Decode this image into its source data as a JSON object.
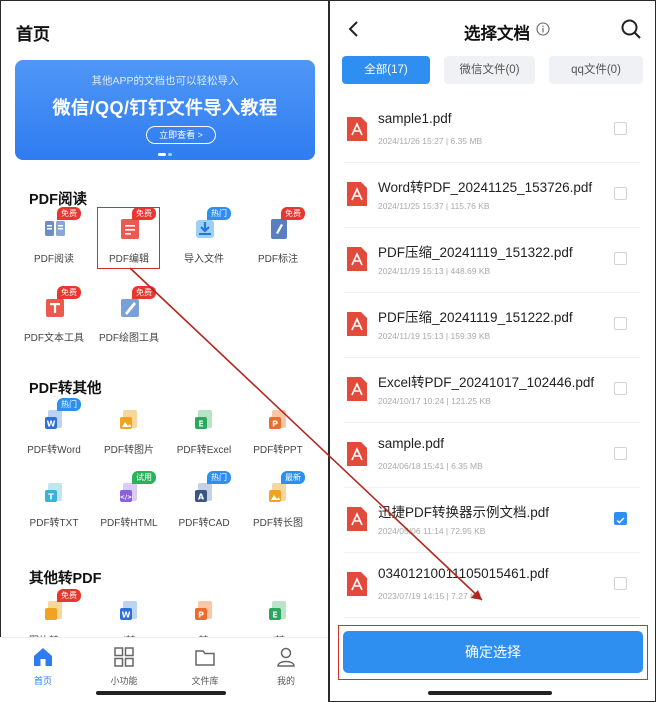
{
  "left": {
    "title": "首页",
    "banner": {
      "subtitle": "其他APP的文档也可以轻松导入",
      "headline": "微信/QQ/钉钉文件导入教程",
      "cta": "立即查看 >"
    },
    "sections": [
      {
        "title": "PDF阅读",
        "tools": [
          {
            "label": "PDF阅读",
            "icon": "book-icon",
            "badge": "免费",
            "badge_color": "#e8372e"
          },
          {
            "label": "PDF编辑",
            "icon": "edit-doc-icon",
            "badge": "免费",
            "badge_color": "#e8372e"
          },
          {
            "label": "导入文件",
            "icon": "import-icon",
            "badge": "热门",
            "badge_color": "#2f8ff0"
          },
          {
            "label": "PDF标注",
            "icon": "annotate-icon",
            "badge": "免费",
            "badge_color": "#e8372e"
          },
          {
            "label": "PDF文本工具",
            "icon": "text-tool-icon",
            "badge": "免费",
            "badge_color": "#e8372e"
          },
          {
            "label": "PDF绘图工具",
            "icon": "draw-tool-icon",
            "badge": "免费",
            "badge_color": "#e8372e"
          }
        ]
      },
      {
        "title": "PDF转其他",
        "tools": [
          {
            "label": "PDF转Word",
            "icon": "word-icon",
            "badge": "热门",
            "badge_color": "#2f8ff0"
          },
          {
            "label": "PDF转图片",
            "icon": "image-icon",
            "badge": "",
            "badge_color": ""
          },
          {
            "label": "PDF转Excel",
            "icon": "excel-icon",
            "badge": "",
            "badge_color": ""
          },
          {
            "label": "PDF转PPT",
            "icon": "ppt-icon",
            "badge": "",
            "badge_color": ""
          },
          {
            "label": "PDF转TXT",
            "icon": "txt-icon",
            "badge": "",
            "badge_color": ""
          },
          {
            "label": "PDF转HTML",
            "icon": "html-icon",
            "badge": "试用",
            "badge_color": "#26b35a"
          },
          {
            "label": "PDF转CAD",
            "icon": "cad-icon",
            "badge": "热门",
            "badge_color": "#2f8ff0"
          },
          {
            "label": "PDF转长图",
            "icon": "long-image-icon",
            "badge": "最新",
            "badge_color": "#2f8ff0"
          }
        ]
      },
      {
        "title": "其他转PDF",
        "tools": [
          {
            "label": "图片转PDF",
            "icon": "image-icon",
            "badge": "免费",
            "badge_color": "#e8372e"
          },
          {
            "label": "Word转PDF",
            "icon": "word-icon",
            "badge": "",
            "badge_color": ""
          },
          {
            "label": "PPT转PDF",
            "icon": "ppt-icon",
            "badge": "",
            "badge_color": ""
          },
          {
            "label": "Excel转PDF",
            "icon": "excel-icon",
            "badge": "",
            "badge_color": ""
          }
        ]
      }
    ],
    "tabbar": [
      {
        "label": "首页",
        "icon": "home-icon",
        "active": true
      },
      {
        "label": "小功能",
        "icon": "grid-icon",
        "active": false
      },
      {
        "label": "文件库",
        "icon": "folder-icon",
        "active": false
      },
      {
        "label": "我的",
        "icon": "user-icon",
        "active": false
      }
    ]
  },
  "right": {
    "title": "选择文档",
    "filters": [
      {
        "label": "全部(17)",
        "active": true
      },
      {
        "label": "微信文件(0)",
        "active": false
      },
      {
        "label": "qq文件(0)",
        "active": false
      }
    ],
    "files": [
      {
        "name": "sample1.pdf",
        "date": "2024/11/26 15:27",
        "size": "6.35 MB",
        "checked": false
      },
      {
        "name": "Word转PDF_20241125_153726.pdf",
        "date": "2024/11/25 15:37",
        "size": "115.76 KB",
        "checked": false
      },
      {
        "name": "PDF压缩_20241119_151322.pdf",
        "date": "2024/11/19 15:13",
        "size": "448.69 KB",
        "checked": false
      },
      {
        "name": "PDF压缩_20241119_151222.pdf",
        "date": "2024/11/19 15:13",
        "size": "159.39 KB",
        "checked": false
      },
      {
        "name": "Excel转PDF_20241017_102446.pdf",
        "date": "2024/10/17 10:24",
        "size": "121.25 KB",
        "checked": false
      },
      {
        "name": "sample.pdf",
        "date": "2024/06/18 15:41",
        "size": "6.35 MB",
        "checked": false
      },
      {
        "name": "迅捷PDF转换器示例文档.pdf",
        "date": "2024/05/06 11:14",
        "size": "72.95 KB",
        "checked": true
      },
      {
        "name": "034012100111050154​61.pdf",
        "date": "2023/07/19 14:15",
        "size": "7.27 KB",
        "checked": false
      }
    ],
    "confirm_label": "确定选择"
  },
  "colors": {
    "accent": "#2f8ff0",
    "highlight": "#d0312d",
    "badge_red": "#e8372e",
    "pdf_red": "#e24a3b"
  }
}
